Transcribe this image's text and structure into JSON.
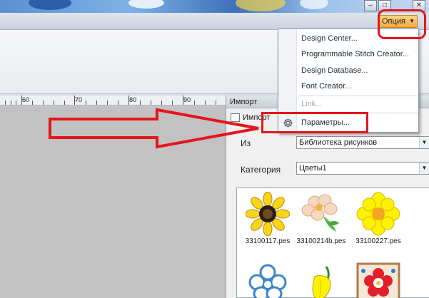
{
  "window": {
    "options_button": "Опция",
    "controls": [
      "–",
      "□",
      "✕"
    ]
  },
  "ruler": {
    "ticks": [
      "60",
      "70",
      "80",
      "90"
    ]
  },
  "import_panel": {
    "header": "Импорт",
    "tab_label": "Импорт",
    "from_label": "Из",
    "from_value": "Библиотека рисунков",
    "category_label": "Категория",
    "category_value": "Цветы1",
    "thumbnails": [
      {
        "name": "33100117.pes",
        "icon": "sunflower-icon"
      },
      {
        "name": "33100214b.pes",
        "icon": "peach-flower-icon"
      },
      {
        "name": "33100227.pes",
        "icon": "yellow-flower-icon"
      },
      {
        "name": "",
        "icon": "blue-flower-icon"
      },
      {
        "name": "",
        "icon": "tulip-icon"
      },
      {
        "name": "",
        "icon": "red-flower-frame-icon"
      }
    ]
  },
  "options_menu": {
    "items": [
      {
        "label": "Design Center...",
        "enabled": true
      },
      {
        "label": "Programmable Stitch Creator...",
        "enabled": true
      },
      {
        "label": "Design Database...",
        "enabled": true
      },
      {
        "label": "Font Creator...",
        "enabled": true
      },
      {
        "label": "Link...",
        "enabled": false
      },
      {
        "label": "Параметры...",
        "enabled": true,
        "icon": "gear-icon"
      }
    ]
  },
  "colors": {
    "highlight": "#e3161c",
    "options_accent": "#f5a93b"
  }
}
